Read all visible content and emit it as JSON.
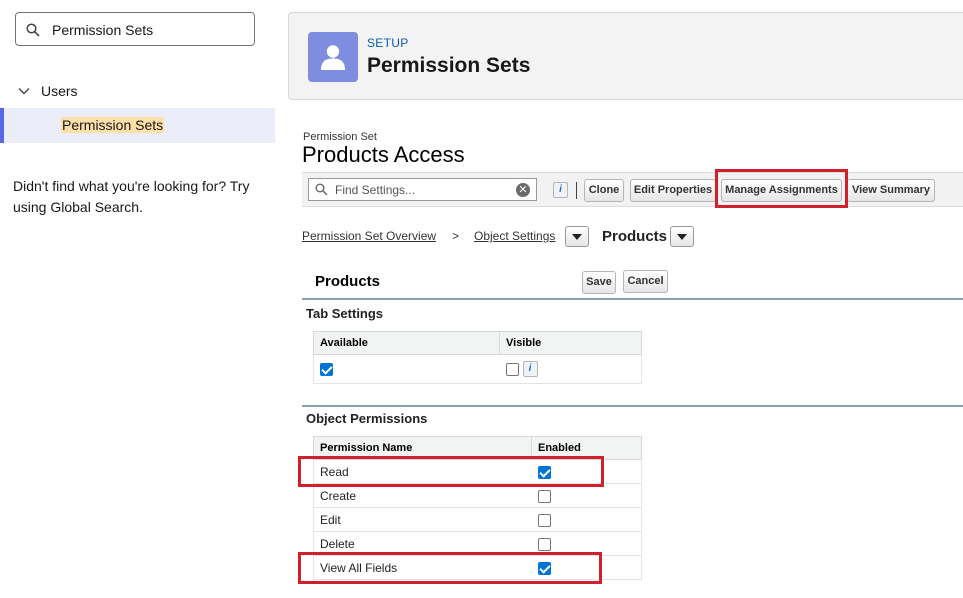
{
  "sidebar": {
    "search_value": "Permission Sets",
    "nav_parent": "Users",
    "nav_child": "Permission Sets",
    "help_text": "Didn't find what you're looking for? Try using Global Search."
  },
  "header": {
    "eyebrow": "SETUP",
    "title": "Permission Sets",
    "icon": "user-icon",
    "icon_color": "#7f8de1"
  },
  "permission_set": {
    "label": "Permission Set",
    "name": "Products Access"
  },
  "toolbar": {
    "find_placeholder": "Find Settings...",
    "info_label": "i",
    "clone_label": "Clone",
    "edit_properties_label": "Edit Properties",
    "manage_assignments_label": "Manage Assignments",
    "view_summary_label": "View Summary"
  },
  "breadcrumb": {
    "overview": "Permission Set Overview",
    "separator": ">",
    "object_settings": "Object Settings",
    "current": "Products"
  },
  "section": {
    "title": "Products",
    "save_label": "Save",
    "cancel_label": "Cancel"
  },
  "tab_settings": {
    "title": "Tab Settings",
    "headers": [
      "Available",
      "Visible"
    ],
    "available_checked": true,
    "visible_checked": false,
    "info_label": "i"
  },
  "object_permissions": {
    "title": "Object Permissions",
    "headers": [
      "Permission Name",
      "Enabled"
    ],
    "rows": [
      {
        "name": "Read",
        "enabled": true
      },
      {
        "name": "Create",
        "enabled": false
      },
      {
        "name": "Edit",
        "enabled": false
      },
      {
        "name": "Delete",
        "enabled": false
      },
      {
        "name": "View All Fields",
        "enabled": true
      }
    ]
  },
  "colors": {
    "highlight_box": "#d0202e",
    "checkbox_on": "#0075d3",
    "nav_selected_bar": "#5867e8"
  }
}
